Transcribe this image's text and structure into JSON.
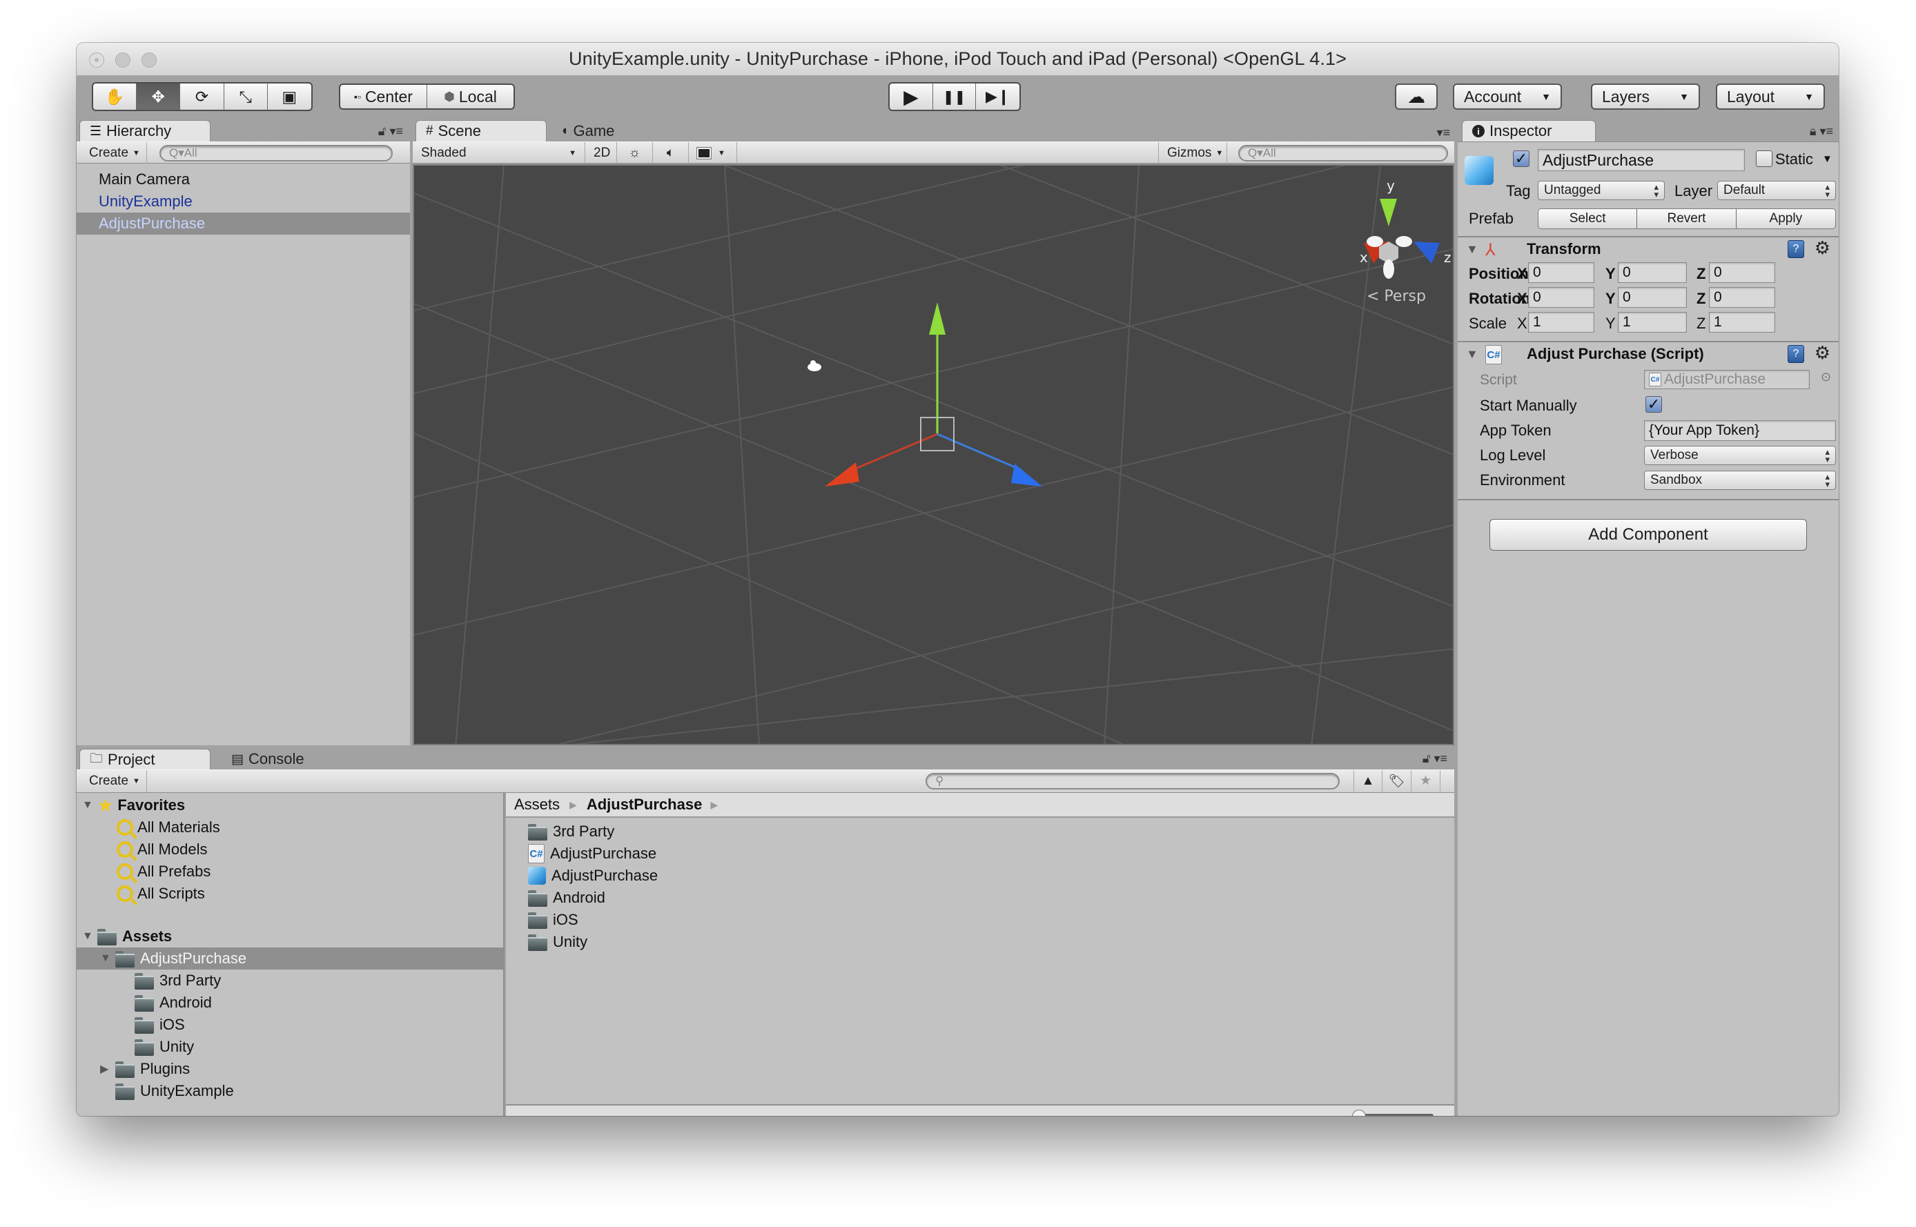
{
  "window": {
    "title": "UnityExample.unity - UnityPurchase - iPhone, iPod Touch and iPad (Personal) <OpenGL 4.1>"
  },
  "toolbar": {
    "transform_tools": [
      {
        "name": "hand-tool",
        "icon": "✋"
      },
      {
        "name": "move-tool",
        "icon": "✥"
      },
      {
        "name": "rotate-tool",
        "icon": "⟳"
      },
      {
        "name": "scale-tool",
        "icon": "⤡"
      },
      {
        "name": "rect-tool",
        "icon": "▣"
      }
    ],
    "active_tool": "move-tool",
    "pivot_mode_label": "Center",
    "pivot_rotation_label": "Local",
    "play_icon": "▶",
    "pause_icon": "❚❚",
    "step_icon": "▶❙",
    "cloud_icon": "☁",
    "account_label": "Account",
    "layers_label": "Layers",
    "layout_label": "Layout"
  },
  "hierarchy": {
    "tab_label": "Hierarchy",
    "create_label": "Create",
    "search_placeholder": "Q▾All",
    "items": [
      {
        "label": "Main Camera",
        "type": "normal",
        "selected": false
      },
      {
        "label": "UnityExample",
        "type": "prefab",
        "selected": false
      },
      {
        "label": "AdjustPurchase",
        "type": "prefab",
        "selected": true
      }
    ]
  },
  "scene": {
    "tab_scene_label": "Scene",
    "tab_game_label": "Game",
    "shading_mode": "Shaded",
    "toggle_2d_label": "2D",
    "gizmos_label": "Gizmos",
    "search_placeholder": "Q▾All",
    "axis_labels": {
      "x": "x",
      "y": "y",
      "z": "z"
    },
    "projection_label": "Persp",
    "colors": {
      "x_axis": "#e2411f",
      "y_axis": "#8fdc3a",
      "z_axis": "#2a6ff0",
      "background": "#474747"
    }
  },
  "inspector": {
    "tab_label": "Inspector",
    "object_active": true,
    "object_name": "AdjustPurchase",
    "static_label": "Static",
    "static_checked": false,
    "tag_label": "Tag",
    "tag_value": "Untagged",
    "layer_label": "Layer",
    "layer_value": "Default",
    "prefab_label": "Prefab",
    "prefab_buttons": [
      "Select",
      "Revert",
      "Apply"
    ],
    "transform": {
      "title": "Transform",
      "rows": [
        {
          "label": "Position",
          "x": "0",
          "y": "0",
          "z": "0"
        },
        {
          "label": "Rotation",
          "x": "0",
          "y": "0",
          "z": "0"
        },
        {
          "label": "Scale",
          "x": "1",
          "y": "1",
          "z": "1"
        }
      ],
      "axis_x": "X",
      "axis_y": "Y",
      "axis_z": "Z"
    },
    "script_component": {
      "title": "Adjust Purchase (Script)",
      "script_label": "Script",
      "script_value": "AdjustPurchase",
      "start_manually_label": "Start Manually",
      "start_manually_checked": true,
      "app_token_label": "App Token",
      "app_token_value": "{Your App Token}",
      "log_level_label": "Log Level",
      "log_level_value": "Verbose",
      "environment_label": "Environment",
      "environment_value": "Sandbox"
    },
    "add_component_label": "Add Component"
  },
  "project": {
    "tab_project_label": "Project",
    "tab_console_label": "Console",
    "create_label": "Create",
    "search_placeholder": "",
    "favorites": {
      "label": "Favorites",
      "items": [
        "All Materials",
        "All Models",
        "All Prefabs",
        "All Scripts"
      ]
    },
    "assets_tree": {
      "label": "Assets",
      "items": [
        {
          "label": "AdjustPurchase",
          "depth": 1,
          "expanded": true,
          "selected": true
        },
        {
          "label": "3rd Party",
          "depth": 2
        },
        {
          "label": "Android",
          "depth": 2
        },
        {
          "label": "iOS",
          "depth": 2
        },
        {
          "label": "Unity",
          "depth": 2
        },
        {
          "label": "Plugins",
          "depth": 1,
          "collapsed": true
        },
        {
          "label": "UnityExample",
          "depth": 1
        }
      ]
    },
    "breadcrumb": [
      "Assets",
      "AdjustPurchase"
    ],
    "contents": [
      {
        "label": "3rd Party",
        "type": "folder"
      },
      {
        "label": "AdjustPurchase",
        "type": "script"
      },
      {
        "label": "AdjustPurchase",
        "type": "prefab"
      },
      {
        "label": "Android",
        "type": "folder"
      },
      {
        "label": "iOS",
        "type": "folder"
      },
      {
        "label": "Unity",
        "type": "folder"
      }
    ],
    "icon_size_slider": 0.0
  }
}
